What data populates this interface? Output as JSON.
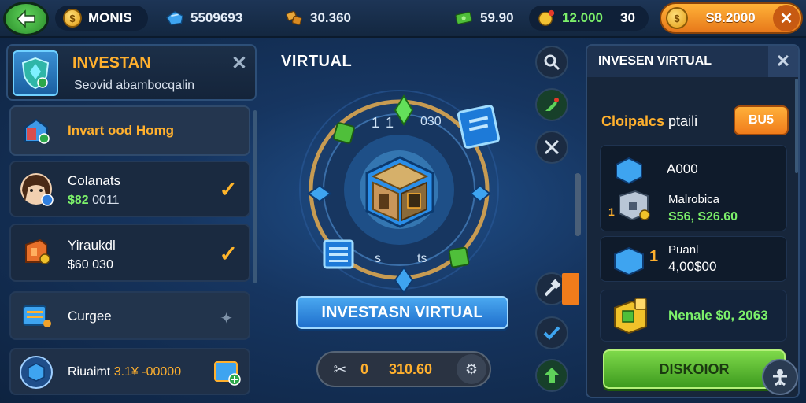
{
  "topbar": {
    "gold": "MONIS",
    "gems": "5509693",
    "shards": "30.360",
    "cash": "59.90",
    "energy_value": "12.000",
    "energy_extra": "30",
    "premium_value": "S8.2000"
  },
  "left_panel": {
    "title": "INVESTAN",
    "subtitle": "Seovid abambocqalin",
    "items": [
      {
        "name": "Invart ood Homg"
      },
      {
        "name": "Colanats",
        "price_a": "$82",
        "price_b": "0011"
      },
      {
        "name": "Yiraukdl",
        "price": "$60 030"
      },
      {
        "name": "Curgee"
      },
      {
        "name": "Riuaimt",
        "value": "3.1¥ -00000"
      }
    ]
  },
  "center": {
    "title": "VIRTUAL",
    "ring_labels": [
      "1",
      "1",
      "030",
      "s",
      "ts"
    ],
    "invest_button": "INVESTASN VIRTUAL",
    "amount_zero": "0",
    "amount_value": "310.60"
  },
  "right_panel": {
    "title": "INVESEN VIRTUAL",
    "section_title_a": "Cloipalcs",
    "section_title_b": "ptaili",
    "badge": "BU5",
    "card1_value": "A000",
    "card1_name": "Malrobica",
    "card1_price": "S56, S26.60",
    "card1_qty": "1",
    "card2_qty": "1",
    "card2_name": "Puanl",
    "card2_value": "4,00$00",
    "card3_name": "Nenale $0, 2063",
    "discover_button": "DISKOIOR"
  },
  "colors": {
    "accent_orange": "#ffb02e",
    "accent_green": "#7cf06a",
    "panel_bg": "#17263b",
    "primary_blue": "#1f6fcc"
  },
  "icons": {
    "back": "arrow-left-icon",
    "coin": "coin-icon",
    "gem": "gem-icon",
    "shards": "shards-icon",
    "cash": "cash-icon",
    "energy": "energy-icon",
    "close": "close-icon",
    "check": "check-icon"
  }
}
